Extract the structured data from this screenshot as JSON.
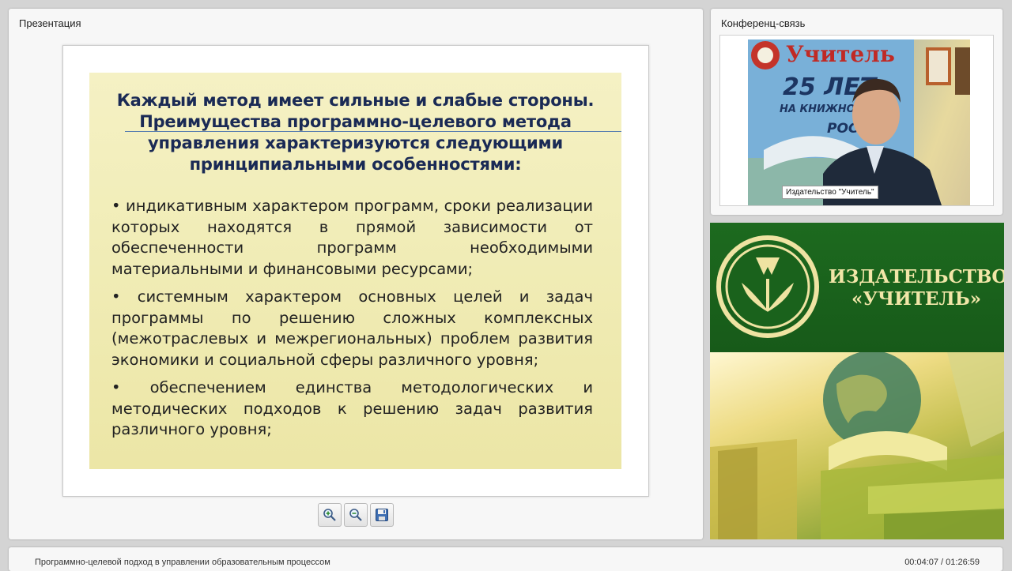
{
  "presentation": {
    "title": "Презентация",
    "slide": {
      "heading": [
        "Каждый метод имеет сильные и слабые стороны.",
        "Преимущества программно-целевого метода",
        "управления характеризуются следующими",
        "принципиальными особенностями:"
      ],
      "bullets": [
        "индикативным характером программ, сроки реализации которых находятся в прямой зависимости от обеспеченности программ необходимыми материальными и финансовыми ресурсами;",
        "системным характером основных целей и задач программы по решению сложных комплексных (межотраслевых и межрегиональных) проблем развития экономики и социальной сферы различного уровня;",
        "обеспечением единства методологических и методических подходов к решению задач развития различного уровня;"
      ]
    },
    "toolbar": {
      "zoom_in_icon": "zoom-in-icon",
      "zoom_out_icon": "zoom-out-icon",
      "save_icon": "floppy-disk-icon"
    }
  },
  "conference": {
    "title": "Конференц-связь",
    "video_caption": "Издательство \"Учитель\"",
    "poster_text": {
      "brand": "Учитель",
      "years": "25 ЛЕТ",
      "line": "НА КНИЖНОМ РЫ",
      "country": "РОСС"
    }
  },
  "banner": {
    "name_line1": "ИЗДАТЕЛЬСТВО",
    "name_line2": "«УЧИТЕЛЬ»"
  },
  "status": {
    "lecture_title": "Программно-целевой подход в управлении образовательным процессом",
    "time": "00:04:07 / 01:26:59"
  },
  "colors": {
    "slide_heading": "#1a2a55",
    "banner_green": "#1f6520",
    "banner_text": "#f1e6a8"
  }
}
